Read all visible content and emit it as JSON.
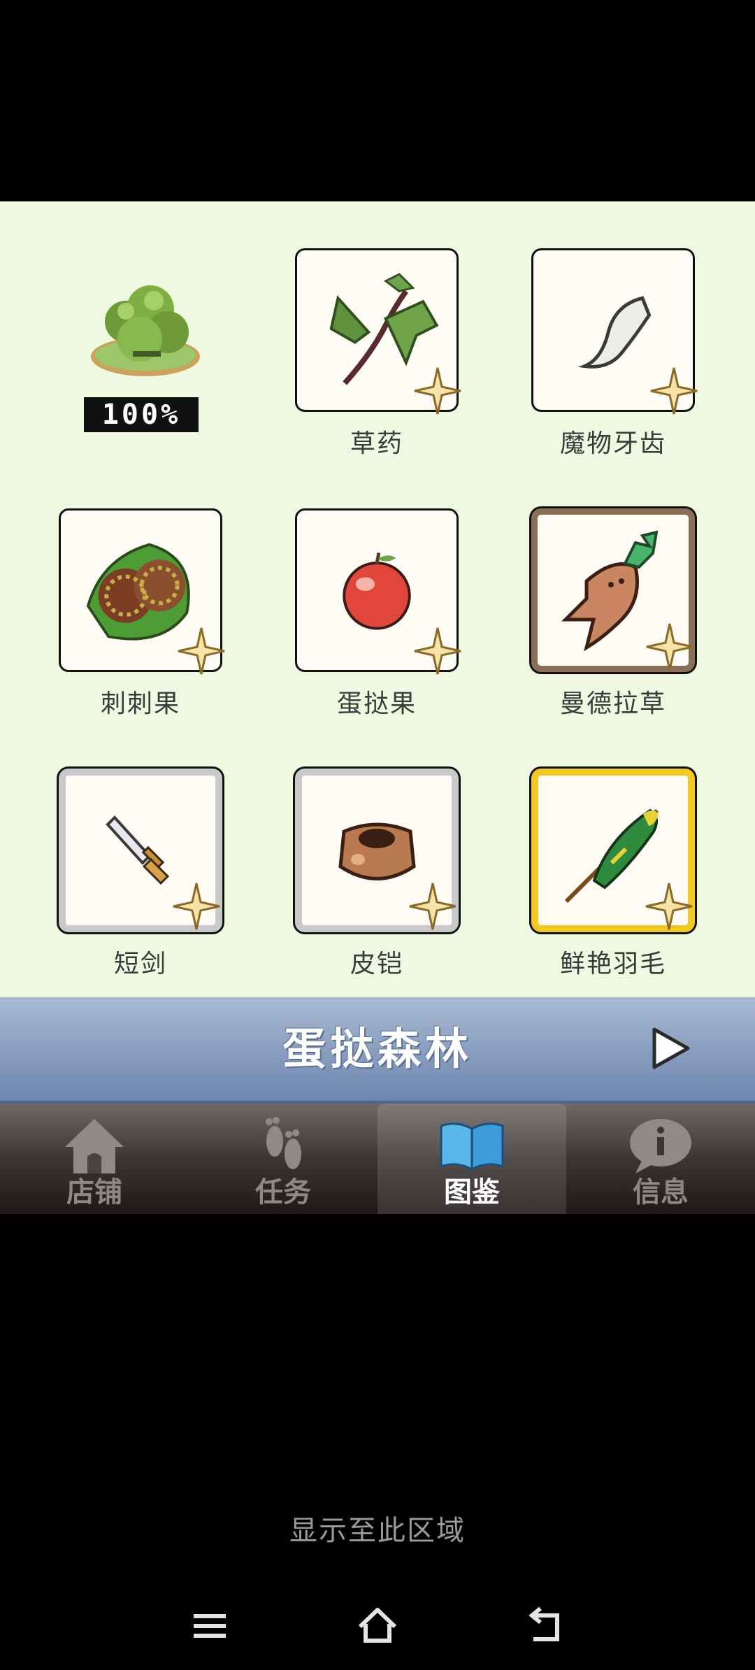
{
  "region": {
    "name": "蛋挞森林",
    "completion": "100%"
  },
  "items": [
    {
      "name": "草药",
      "frame": "plain"
    },
    {
      "name": "魔物牙齿",
      "frame": "plain"
    },
    {
      "name": "刺刺果",
      "frame": "plain"
    },
    {
      "name": "蛋挞果",
      "frame": "plain"
    },
    {
      "name": "曼德拉草",
      "frame": "brown"
    },
    {
      "name": "短剑",
      "frame": "silver"
    },
    {
      "name": "皮铠",
      "frame": "silver"
    },
    {
      "name": "鲜艳羽毛",
      "frame": "gold"
    }
  ],
  "tabs": [
    {
      "label": "店铺",
      "icon": "house-icon"
    },
    {
      "label": "任务",
      "icon": "footprints-icon"
    },
    {
      "label": "图鉴",
      "icon": "open-book-icon",
      "active": true
    },
    {
      "label": "信息",
      "icon": "info-bubble-icon"
    }
  ],
  "hint": "显示至此区域",
  "colors": {
    "background": "#EFF8E0",
    "banner": "#8DA2C2",
    "tabbar": "#3b3533",
    "gold_frame": "#F2C824",
    "brown_frame": "#8C6F57",
    "silver_frame": "#C9C9C9"
  }
}
